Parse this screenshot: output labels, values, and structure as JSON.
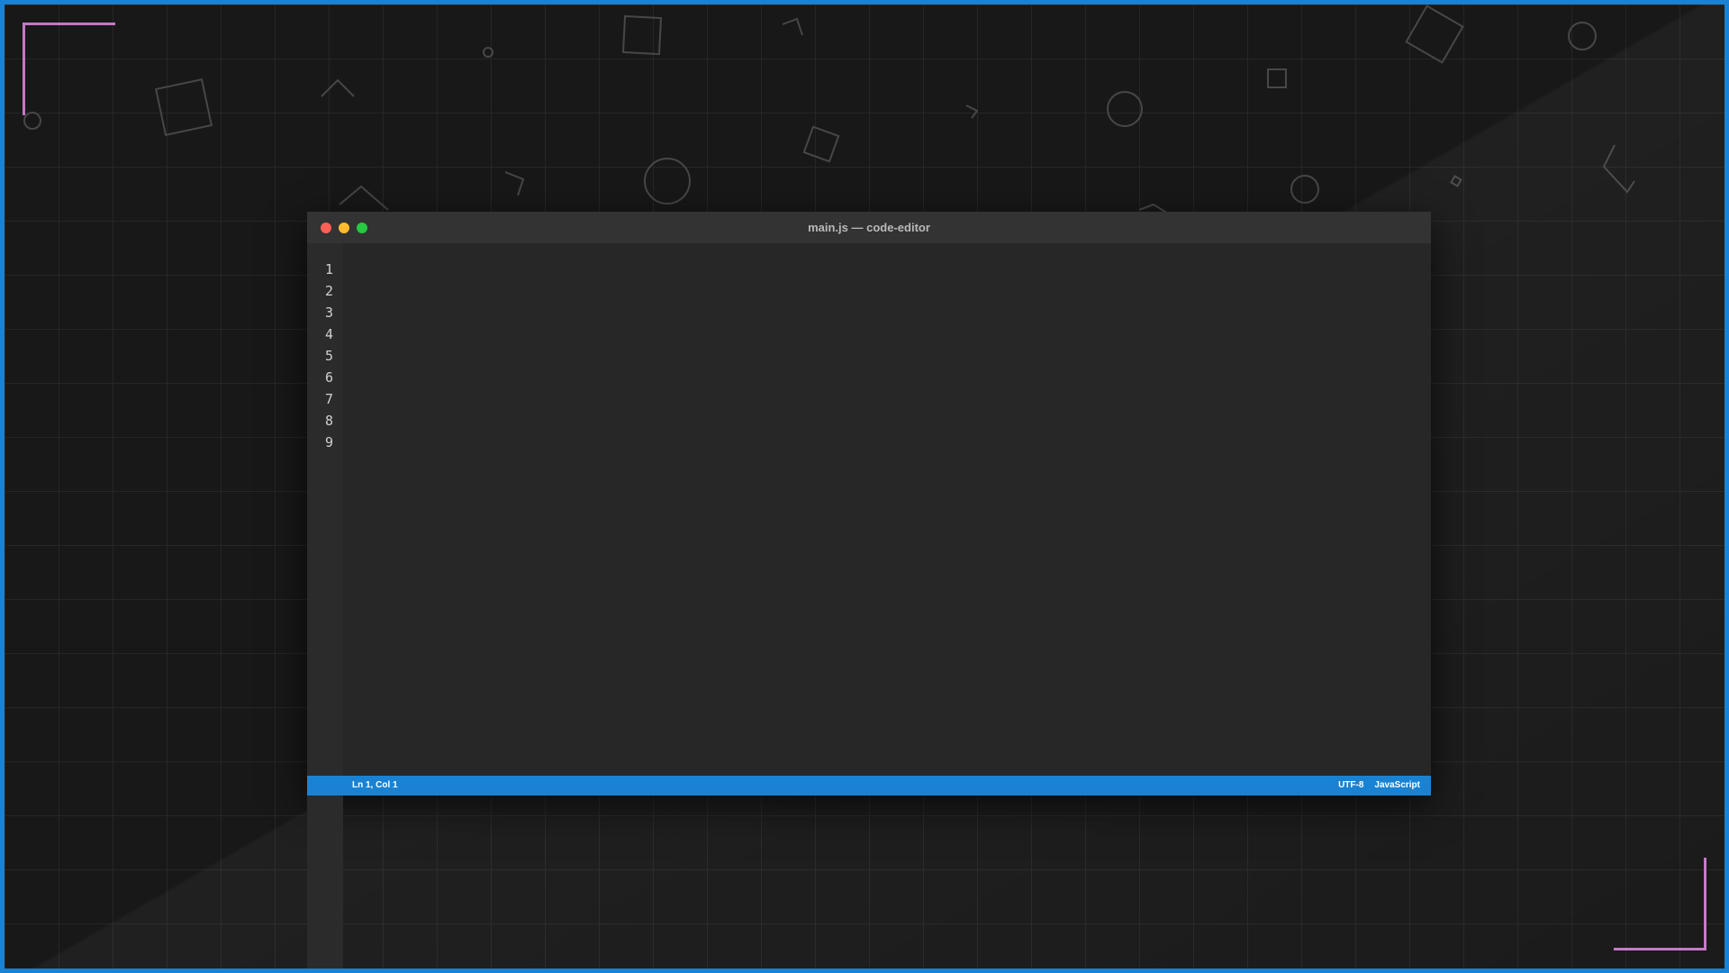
{
  "window": {
    "title": "main.js — code-editor"
  },
  "editor": {
    "line_numbers": [
      "1",
      "2",
      "3",
      "4",
      "5",
      "6",
      "7",
      "8",
      "9"
    ]
  },
  "statusbar": {
    "cursor_position": "Ln 1, Col 1",
    "encoding": "UTF-8",
    "language": "JavaScript"
  },
  "colors": {
    "accent": "#1a82d2",
    "bracket": "#c478c6",
    "traffic_close": "#ff5f57",
    "traffic_minimize": "#febc2e",
    "traffic_maximize": "#28c840"
  }
}
